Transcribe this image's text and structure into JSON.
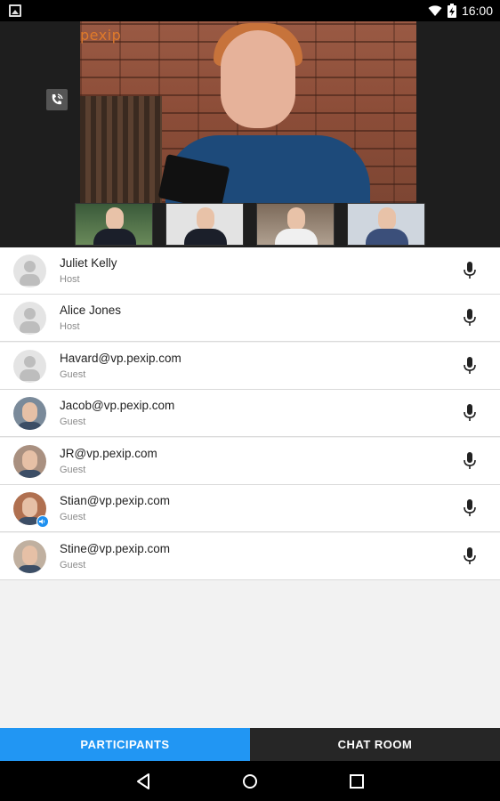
{
  "status_bar": {
    "time": "16:00",
    "icons": [
      "image-notification-icon",
      "wifi-icon",
      "battery-charging-icon"
    ]
  },
  "video": {
    "brand_logo": "pexip",
    "call_button_icon": "phone-call-icon"
  },
  "participants": [
    {
      "name": "Juliet Kelly",
      "role": "Host",
      "avatar": "generic-avatar",
      "mic_icon": "microphone-icon"
    },
    {
      "name": "Alice Jones",
      "role": "Host",
      "avatar": "generic-avatar",
      "mic_icon": "microphone-icon"
    },
    {
      "name": "Havard@vp.pexip.com",
      "role": "Guest",
      "avatar": "generic-avatar",
      "mic_icon": "microphone-icon"
    },
    {
      "name": "Jacob@vp.pexip.com",
      "role": "Guest",
      "avatar": "photo-avatar",
      "mic_icon": "microphone-icon"
    },
    {
      "name": "JR@vp.pexip.com",
      "role": "Guest",
      "avatar": "photo-avatar",
      "mic_icon": "microphone-icon"
    },
    {
      "name": "Stian@vp.pexip.com",
      "role": "Guest",
      "avatar": "photo-avatar",
      "mic_icon": "microphone-icon",
      "speaking": true
    },
    {
      "name": "Stine@vp.pexip.com",
      "role": "Guest",
      "avatar": "photo-avatar",
      "mic_icon": "microphone-icon"
    }
  ],
  "tabs": {
    "participants": "PARTICIPANTS",
    "chat_room": "CHAT ROOM",
    "active": "participants"
  },
  "colors": {
    "accent": "#2196f3",
    "tab_inactive": "#262626",
    "list_background": "#f2f2f2"
  },
  "nav": {
    "icons": [
      "back-icon",
      "home-icon",
      "recents-icon"
    ]
  }
}
